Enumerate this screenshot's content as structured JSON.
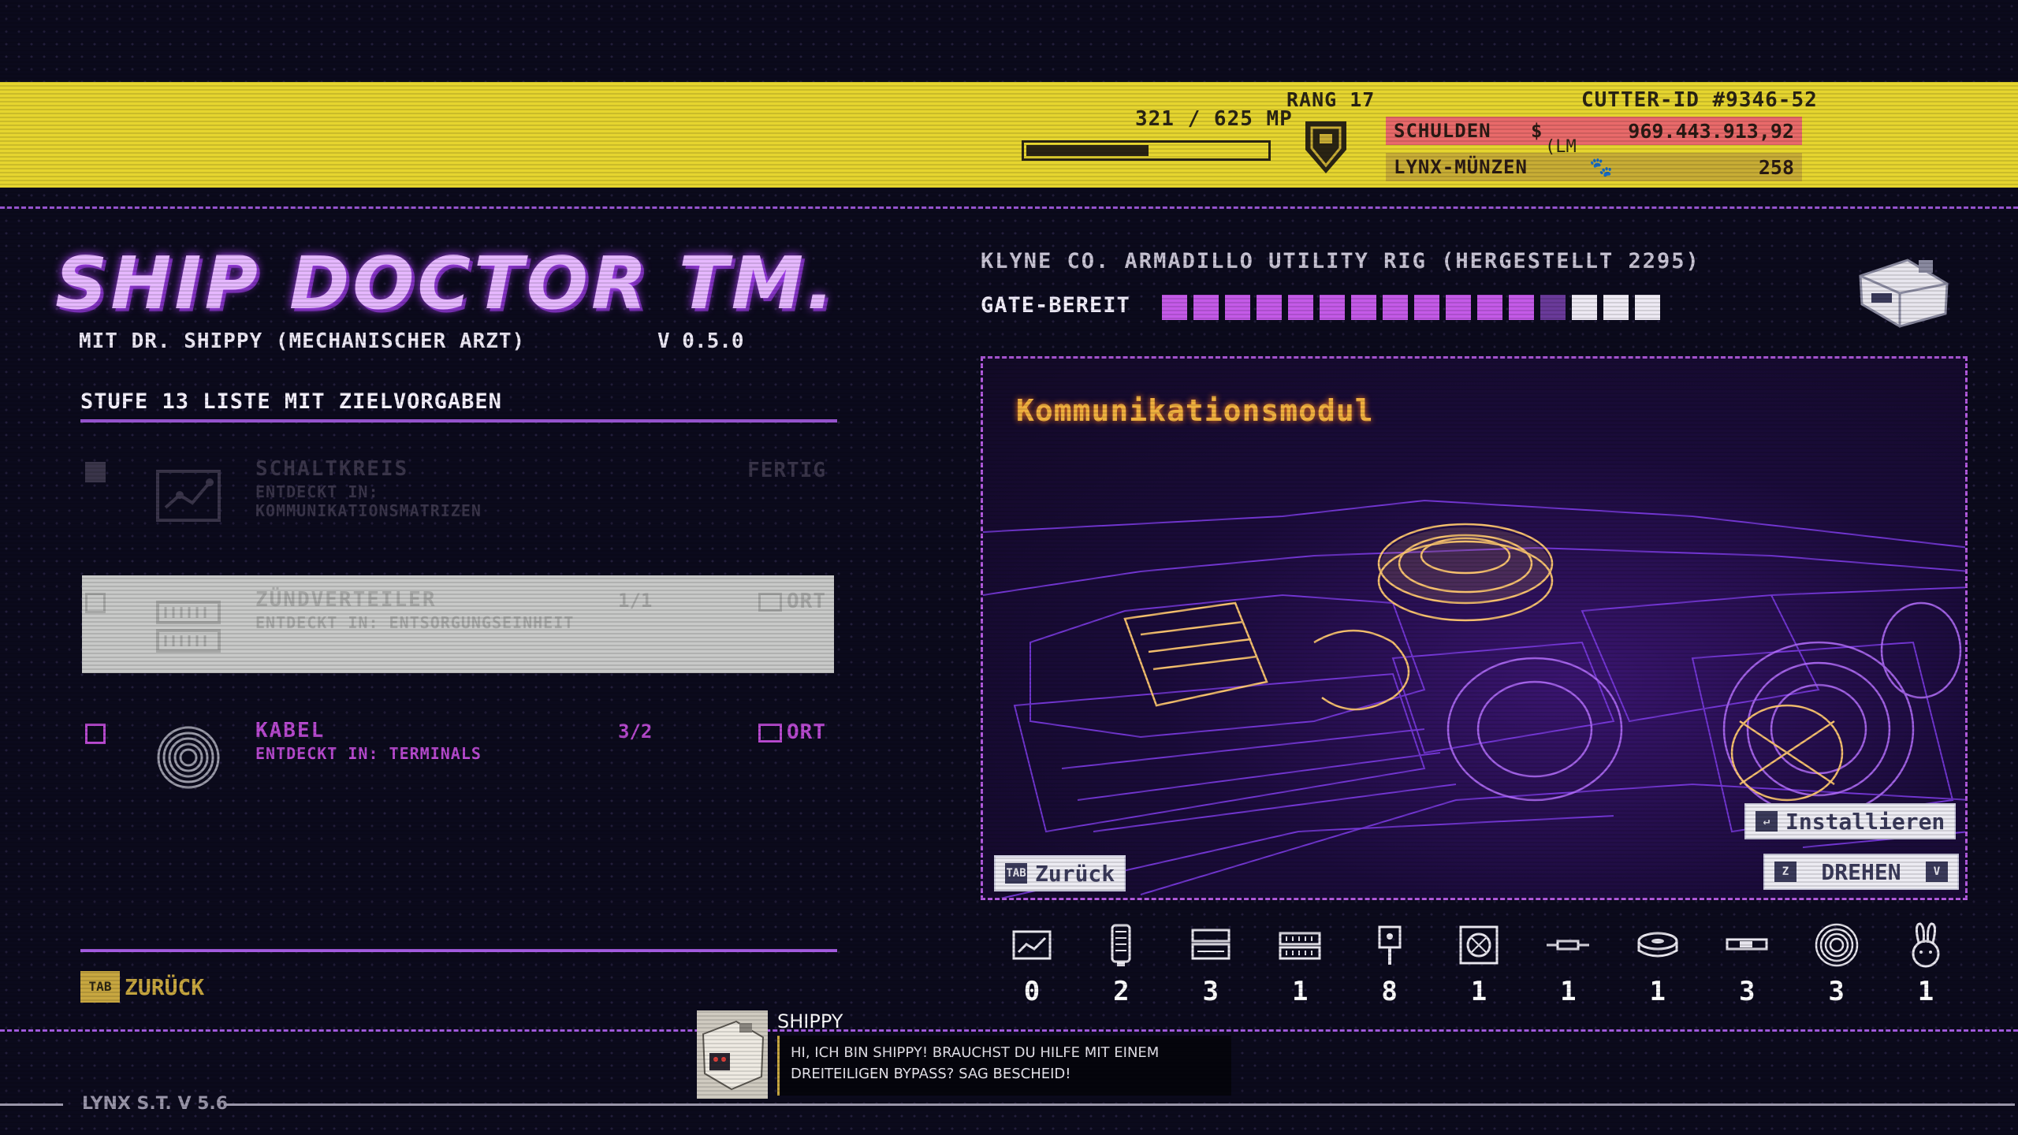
{
  "header": {
    "mp_text": "321 / 625 MP",
    "mp_progress": 0.51,
    "rank": "RANG 17",
    "cutter_id": "CUTTER-ID  #9346-52",
    "debt_label": "SCHULDEN",
    "debt_symbol": "$",
    "debt_value": "969.443.913,92",
    "lm_tag": "(LM",
    "coins_label": "LYNX-MÜNZEN",
    "coins_value": "258",
    "colors": {
      "bar": "#e6d52f",
      "debt": "#e96a6a",
      "coins": "#c8ad35"
    }
  },
  "app": {
    "title": "SHIP DOCTOR TM.",
    "subtitle": "MIT DR. SHIPPY (MECHANISCHER ARZT)",
    "version": "V 0.5.0",
    "list_heading": "STUFE 13 LISTE MIT ZIELVORGABEN"
  },
  "objectives": [
    {
      "name": "SCHALTKREIS",
      "found": "ENTDECKT IN: KOMMUNIKATIONSMATRIZEN",
      "count": "",
      "location": "FERTIG",
      "icon": "circuit-icon",
      "state": "done"
    },
    {
      "name": "ZÜNDVERTEILER",
      "found": "ENTDECKT IN: ENTSORGUNGSEINHEIT",
      "count": "1/1",
      "location": "ORT",
      "icon": "distributor-icon",
      "state": "selected"
    },
    {
      "name": "KABEL",
      "found": "ENTDECKT IN: TERMINALS",
      "count": "3/2",
      "location": "ORT",
      "icon": "cable-coil-icon",
      "state": "active"
    }
  ],
  "back": {
    "key": "TAB",
    "label": "ZURÜCK"
  },
  "ship": {
    "name": "KLYNE CO. ARMADILLO UTILITY RIG (HERGESTELLT 2295)",
    "gate_label": "GATE-BEREIT",
    "gate_filled": 12,
    "gate_partial": 1,
    "gate_empty": 3
  },
  "viewer": {
    "title": "Kommunikationsmodul",
    "back_key": "TAB",
    "back_label": "Zurück",
    "install_label": "Installieren",
    "rotate_key_left": "Z",
    "rotate_label": "DREHEN",
    "rotate_key_right": "V"
  },
  "inventory": [
    {
      "icon": "circuit-board-icon",
      "count": "0"
    },
    {
      "icon": "canister-icon",
      "count": "2"
    },
    {
      "icon": "stacked-module-icon",
      "count": "3"
    },
    {
      "icon": "distributor-icon",
      "count": "1"
    },
    {
      "icon": "connector-icon",
      "count": "8"
    },
    {
      "icon": "fan-box-icon",
      "count": "1"
    },
    {
      "icon": "fuse-icon",
      "count": "1"
    },
    {
      "icon": "tape-roll-icon",
      "count": "1"
    },
    {
      "icon": "rod-icon",
      "count": "3"
    },
    {
      "icon": "cable-coil-icon",
      "count": "3"
    },
    {
      "icon": "bunny-icon",
      "count": "1"
    }
  ],
  "shippy": {
    "name": "SHIPPY",
    "line1": "HI, ICH BIN SHIPPY! BRAUCHST DU HILFE MIT EINEM",
    "line2": "DREITEILIGEN BYPASS? SAG BESCHEID!"
  },
  "footer": {
    "label": "LYNX S.T. V 5.6"
  }
}
